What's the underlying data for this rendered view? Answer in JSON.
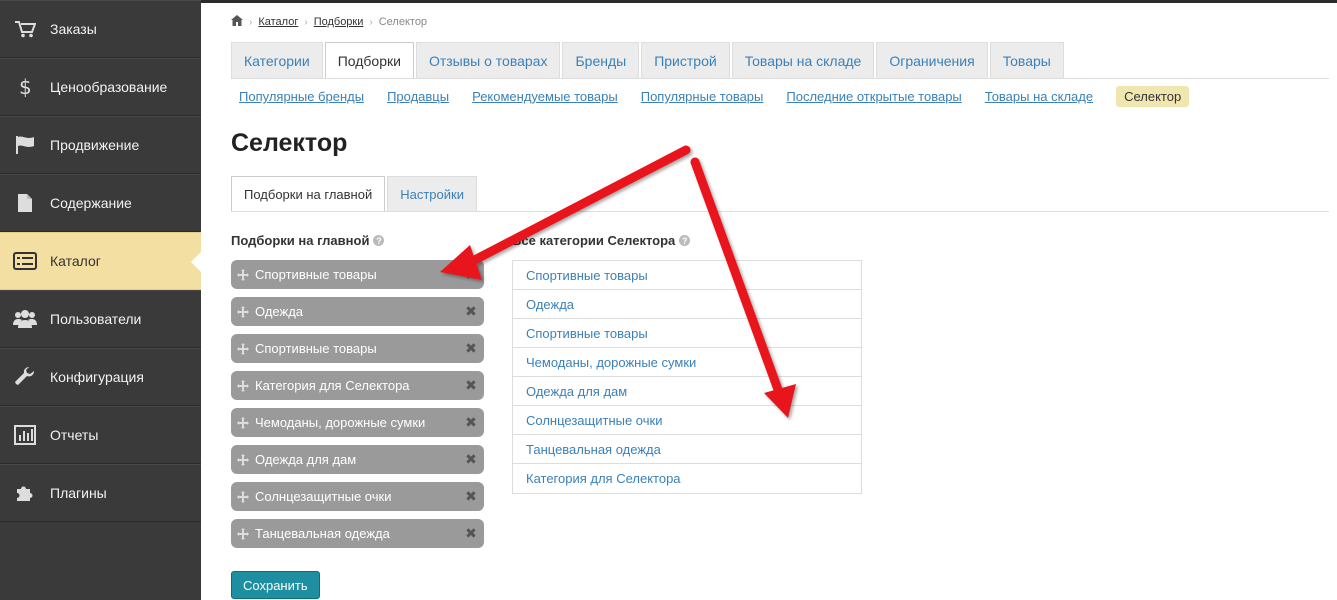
{
  "sidebar": {
    "items": [
      {
        "label": "Заказы",
        "icon": "cart-icon"
      },
      {
        "label": "Ценообразование",
        "icon": "dollar-icon"
      },
      {
        "label": "Продвижение",
        "icon": "flag-icon"
      },
      {
        "label": "Содержание",
        "icon": "document-icon"
      },
      {
        "label": "Каталог",
        "icon": "list-icon"
      },
      {
        "label": "Пользователи",
        "icon": "users-icon"
      },
      {
        "label": "Конфигурация",
        "icon": "wrench-icon"
      },
      {
        "label": "Отчеты",
        "icon": "bar-chart-icon"
      },
      {
        "label": "Плагины",
        "icon": "puzzle-icon"
      }
    ],
    "active_index": 4
  },
  "breadcrumb": {
    "home_icon": "home-icon",
    "items": [
      "Каталог",
      "Подборки",
      "Селектор"
    ]
  },
  "tabs": [
    "Категории",
    "Подборки",
    "Отзывы о товарах",
    "Бренды",
    "Пристрой",
    "Товары на складе",
    "Ограничения",
    "Товары"
  ],
  "active_tab_index": 1,
  "subnav": {
    "links": [
      "Популярные бренды",
      "Продавцы",
      "Рекомендуемые товары",
      "Популярные товары",
      "Последние открытые товары",
      "Товары на складе"
    ],
    "active": "Селектор"
  },
  "page_title": "Селектор",
  "inner_tabs": [
    "Подборки на главной",
    "Настройки"
  ],
  "active_inner_tab_index": 0,
  "left_column": {
    "heading": "Подборки на главной",
    "items": [
      "Спортивные товары",
      "Одежда",
      "Спортивные товары",
      "Категория для Селектора",
      "Чемоданы, дорожные сумки",
      "Одежда для дам",
      "Солнцезащитные очки",
      "Танцевальная одежда"
    ]
  },
  "right_column": {
    "heading": "Все категории Селектора",
    "items": [
      "Спортивные товары",
      "Одежда",
      "Спортивные товары",
      "Чемоданы, дорожные сумки",
      "Одежда для дам",
      "Солнцезащитные очки",
      "Танцевальная одежда",
      "Категория для Селектора"
    ]
  },
  "save_label": "Сохранить",
  "colors": {
    "sidebar_bg": "#3a3a3a",
    "active_item": "#f3dfa2",
    "link": "#3b80b8",
    "chip": "#9a9a9a",
    "save": "#1d8fa0",
    "arrow": "#e8161b"
  }
}
